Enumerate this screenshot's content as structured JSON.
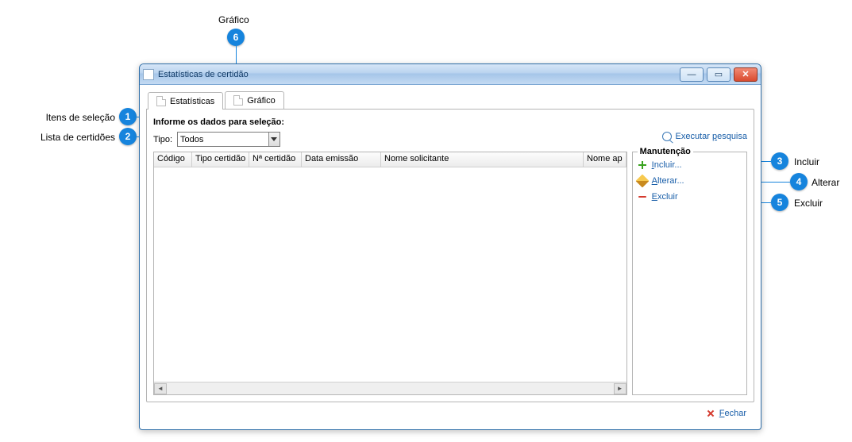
{
  "window": {
    "title": "Estatísticas de certidão"
  },
  "tabs": {
    "stats": "Estatísticas",
    "chart": "Gráfico"
  },
  "selection": {
    "heading": "Informe os dados para seleção:",
    "type_label": "Tipo:",
    "type_value": "Todos",
    "execute_label": "Executar pesquisa",
    "execute_hotkey": "p"
  },
  "grid": {
    "columns": [
      "Código",
      "Tipo certidão",
      "Nª certidão",
      "Data emissão",
      "Nome solicitante",
      "Nome ap"
    ]
  },
  "maintenance": {
    "legend": "Manutenção",
    "include": "Incluir...",
    "include_hotkey": "I",
    "edit": "Alterar...",
    "edit_hotkey": "A",
    "delete": "Excluir",
    "delete_hotkey": "E"
  },
  "footer": {
    "close": "Fechar",
    "close_hotkey": "F"
  },
  "callouts": {
    "c1": "Itens de seleção",
    "c2": "Lista de certidões",
    "c3": "Incluir",
    "c4": "Alterar",
    "c5": "Excluir",
    "c6": "Gráfico"
  }
}
